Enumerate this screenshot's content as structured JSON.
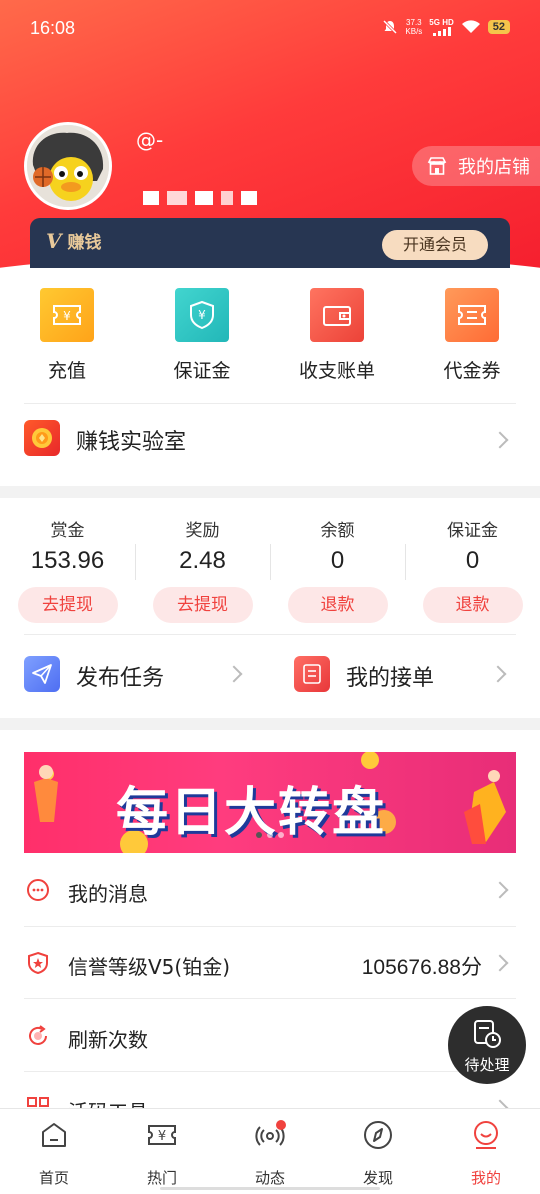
{
  "status_bar": {
    "time": "16:08",
    "net_speed_value": "37.3",
    "net_speed_unit": "KB/s",
    "network": "5G HD",
    "battery": "52"
  },
  "profile": {
    "username": "@-",
    "shop_button": "我的店铺"
  },
  "vip": {
    "label": "赚钱",
    "button": "开通会员"
  },
  "quick_actions": [
    {
      "label": "充值",
      "icon": "recharge-ticket-icon",
      "color": "#ffb11a"
    },
    {
      "label": "保证金",
      "icon": "shield-yen-icon",
      "color": "#2ec5c0"
    },
    {
      "label": "收支账单",
      "icon": "wallet-icon",
      "color": "#f2564a"
    },
    {
      "label": "代金券",
      "icon": "coupon-icon",
      "color": "#ff7a45"
    }
  ],
  "lab": {
    "label": "赚钱实验室"
  },
  "balances": [
    {
      "label": "赏金",
      "value": "153.96",
      "button": "去提现"
    },
    {
      "label": "奖励",
      "value": "2.48",
      "button": "去提现"
    },
    {
      "label": "余额",
      "value": "0",
      "button": "退款"
    },
    {
      "label": "保证金",
      "value": "0",
      "button": "退款"
    }
  ],
  "tasks": {
    "publish": "发布任务",
    "orders": "我的接单"
  },
  "banner": {
    "text": "每日大转盘",
    "slides": 3,
    "active_slide": 1
  },
  "menu": [
    {
      "label": "我的消息",
      "value": "",
      "icon": "message-bubble-icon"
    },
    {
      "label": "信誉等级V5(铂金)",
      "value": "105676.88分",
      "icon": "shield-star-icon"
    },
    {
      "label": "刷新次数",
      "value": "",
      "icon": "refresh-icon"
    },
    {
      "label": "活码工具",
      "value": "",
      "icon": "qrcode-icon"
    }
  ],
  "pending": {
    "label": "待处理"
  },
  "tabbar": [
    {
      "label": "首页",
      "icon": "home-icon",
      "active": false
    },
    {
      "label": "热门",
      "icon": "hot-yen-icon",
      "active": false
    },
    {
      "label": "动态",
      "icon": "broadcast-icon",
      "active": false
    },
    {
      "label": "发现",
      "icon": "compass-icon",
      "active": false
    },
    {
      "label": "我的",
      "icon": "profile-smile-icon",
      "active": true
    }
  ],
  "colors": {
    "brand_red": "#f0423e",
    "vip_navy": "#273652",
    "vip_gold": "#e8c99a"
  }
}
